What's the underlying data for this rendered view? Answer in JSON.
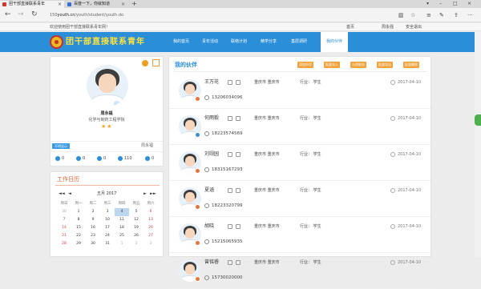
{
  "browser": {
    "tabs": [
      {
        "title": "团干部直接联系青年",
        "color": "#d9362b",
        "active": true
      },
      {
        "title": "百度一下，你就知道",
        "color": "#3b6fd8",
        "active": false
      }
    ],
    "new_tab": "+",
    "url_prefix": "150",
    "url_domain": "youth.cn",
    "url_path": "/youth/student/youth.do"
  },
  "topstrip": {
    "welcome": "欢迎使用团干部直接联系青年网！",
    "home": "首页",
    "user": "周永强",
    "logout": "安全退出"
  },
  "header": {
    "logo_text": "团干部直接联系青年",
    "nav": [
      "我的首页",
      "青年活动",
      "联络计划",
      "精学分享",
      "基层调研",
      "我的伙伴"
    ],
    "active_nav": 5,
    "brand_color": "#2b8ed9"
  },
  "profile": {
    "name": "周永福",
    "org": "化学与制药工程学院",
    "stars": "★★",
    "tag": "不明显示",
    "right_name": "周永福",
    "stats": [
      "0",
      "0",
      "0",
      "110",
      "0"
    ]
  },
  "calendar": {
    "title": "工作日历",
    "month_label": "五月 2017",
    "prev_year": "◄◄",
    "prev": "◄",
    "next": "►",
    "next_year": "►►",
    "weekdays": [
      "周日",
      "周一",
      "周二",
      "周三",
      "周四",
      "周五",
      "周六"
    ],
    "weeks": [
      [
        "30",
        "1",
        "2",
        "3",
        "4",
        "5",
        "6"
      ],
      [
        "7",
        "8",
        "9",
        "10",
        "11",
        "12",
        "13"
      ],
      [
        "14",
        "15",
        "16",
        "17",
        "18",
        "19",
        "20"
      ],
      [
        "21",
        "22",
        "23",
        "24",
        "25",
        "26",
        "27"
      ],
      [
        "28",
        "29",
        "30",
        "31",
        "1",
        "2",
        "3"
      ]
    ],
    "selected": "4"
  },
  "main": {
    "title": "我的伙伴",
    "buttons": [
      "添加伙伴",
      "批量导入",
      "与他联系",
      "批量导出",
      "批量删除"
    ],
    "partners": [
      {
        "name": "王万花",
        "location": "重庆市 重庆市",
        "industry": "行业： 学生",
        "date": "2017-04-10",
        "phone": "13206034096",
        "dot": "#e8743b"
      },
      {
        "name": "何雨毅",
        "location": "重庆市 重庆市",
        "industry": "行业： 学生",
        "date": "2017-04-10",
        "phone": "18223574569",
        "dot": "#3a8fd8"
      },
      {
        "name": "刘翊园",
        "location": "重庆市 重庆市",
        "industry": "行业： 学生",
        "date": "2017-04-10",
        "phone": "18315167293",
        "dot": "#e8743b"
      },
      {
        "name": "夏涵",
        "location": "重庆市 重庆市",
        "industry": "行业： 学生",
        "date": "2017-04-10",
        "phone": "18223320799",
        "dot": "#e8743b"
      },
      {
        "name": "胡晓",
        "location": "重庆市 重庆市",
        "industry": "行业： 学生",
        "date": "2017-04-10",
        "phone": "15215065935",
        "dot": "#e8743b"
      },
      {
        "name": "曾铭睿",
        "location": "重庆市 重庆市",
        "industry": "行业： 学生",
        "date": "2017-04-10",
        "phone": "15730020000",
        "dot": "#e8743b"
      }
    ]
  }
}
